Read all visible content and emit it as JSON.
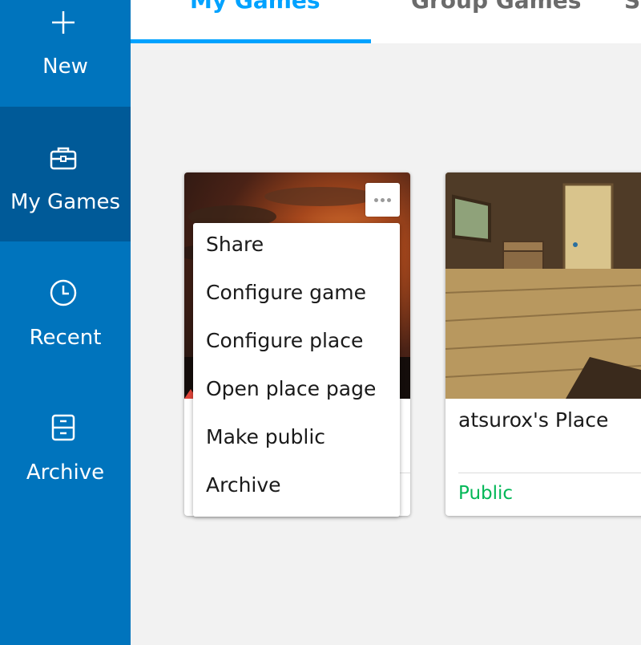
{
  "sidebar": {
    "items": [
      {
        "label": "New",
        "icon": "plus-icon"
      },
      {
        "label": "My Games",
        "icon": "briefcase-icon",
        "active": true
      },
      {
        "label": "Recent",
        "icon": "clock-icon"
      },
      {
        "label": "Archive",
        "icon": "archive-icon"
      }
    ]
  },
  "tabs": [
    {
      "label": "My Games",
      "active": true
    },
    {
      "label": "Group Games"
    },
    {
      "label": "S"
    }
  ],
  "cards": [
    {
      "title": "",
      "status": ""
    },
    {
      "title": "atsurox's Place",
      "status": "Public"
    }
  ],
  "context_menu": {
    "items": [
      "Share",
      "Configure game",
      "Configure place",
      "Open place page",
      "Make public",
      "Archive"
    ]
  },
  "colors": {
    "sidebar_bg": "#0074bd",
    "sidebar_active": "#005a98",
    "accent": "#00a2ff",
    "public_green": "#02b757"
  }
}
